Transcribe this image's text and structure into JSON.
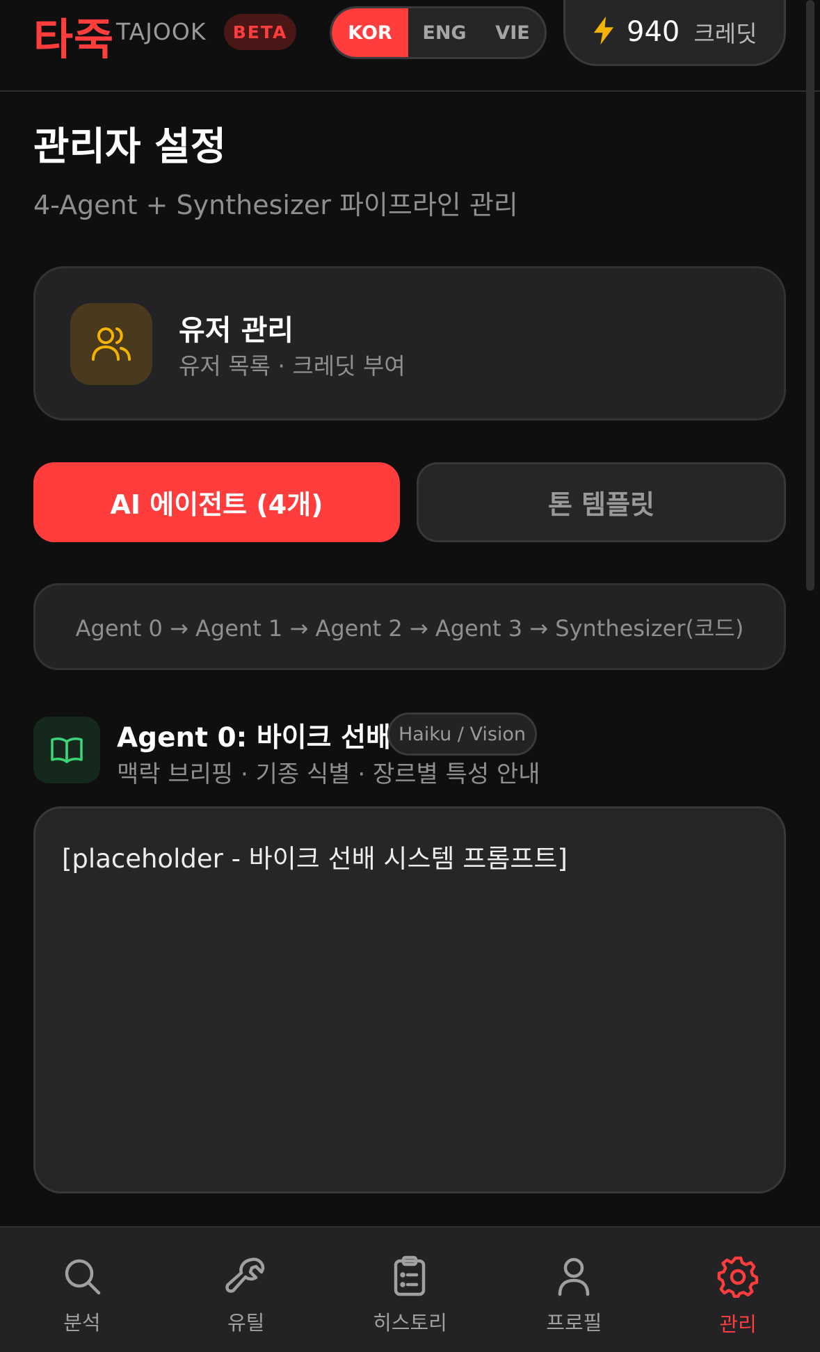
{
  "header": {
    "logo_kr": "타죽",
    "logo_en": "TAJOOK",
    "badge": "BETA",
    "languages": [
      "KOR",
      "ENG",
      "VIE"
    ],
    "active_language": "KOR",
    "credits": {
      "value": "940",
      "unit": "크레딧",
      "icon": "lightning-icon"
    }
  },
  "page": {
    "title": "관리자 설정",
    "subtitle": "4-Agent + Synthesizer 파이프라인 관리"
  },
  "user_card": {
    "icon": "users-icon",
    "title": "유저 관리",
    "description": "유저 목록 · 크레딧 부여"
  },
  "tabs": {
    "agents": "AI 에이전트 (4개)",
    "tone": "톤 템플릿",
    "active": "agents"
  },
  "pipeline": "Agent 0 → Agent 1 → Agent 2 → Agent 3 → Synthesizer(코드)",
  "agent0": {
    "icon": "book-open-icon",
    "title": "Agent 0: 바이크 선배",
    "badge": "Haiku / Vision",
    "description": "맥락 브리핑 · 기종 식별 · 장르별 특성 안내",
    "prompt": "[placeholder - 바이크 선배 시스템 프롬프트]"
  },
  "nav": {
    "items": [
      {
        "label": "분석",
        "icon": "search-icon"
      },
      {
        "label": "유틸",
        "icon": "wrench-icon"
      },
      {
        "label": "히스토리",
        "icon": "clipboard-icon"
      },
      {
        "label": "프로필",
        "icon": "user-icon"
      },
      {
        "label": "관리",
        "icon": "gear-icon"
      }
    ],
    "active": "관리"
  },
  "colors": {
    "accent": "#ff3d3d",
    "background": "#0f0f10",
    "surface": "#232325",
    "credit_icon": "#f5b301",
    "users_icon": "#f5b301",
    "agent_icon": "#3ed47a"
  }
}
